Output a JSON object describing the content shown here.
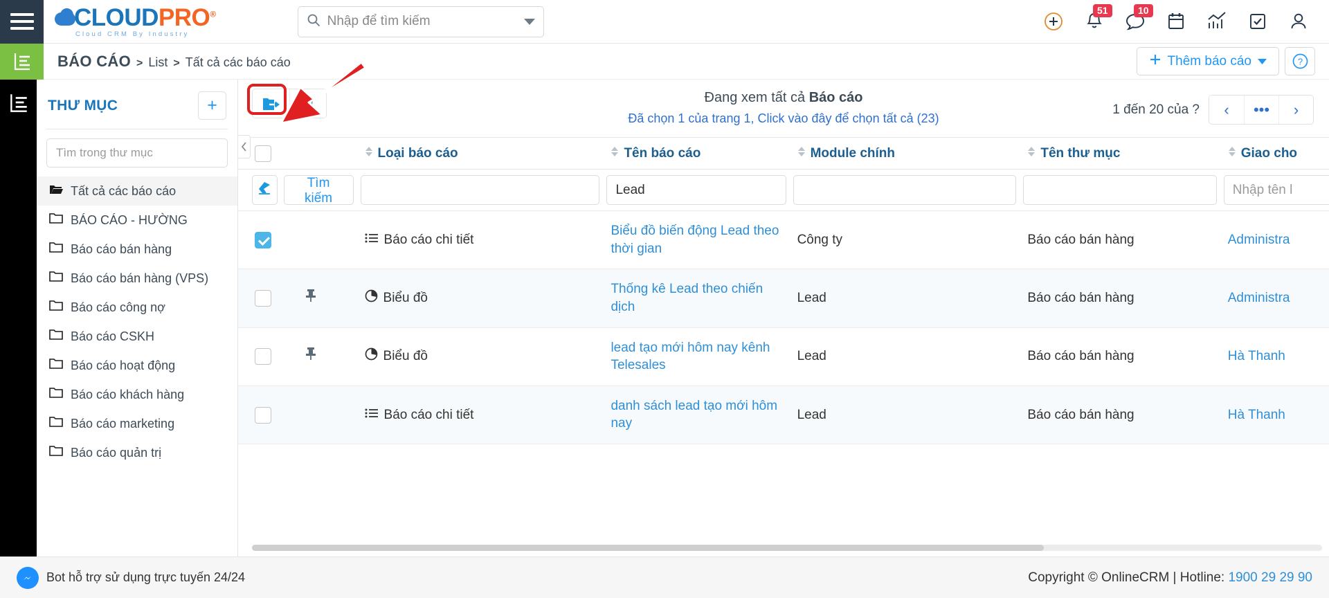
{
  "topbar": {
    "menu_icon": "hamburger-icon",
    "logo": {
      "part1": "CLOUD",
      "part2": "PRO",
      "reg": "®",
      "tagline": "Cloud CRM By Industry"
    },
    "search": {
      "placeholder": "Nhập để tìm kiếm",
      "value": ""
    },
    "icons": [
      {
        "name": "add-icon",
        "badge": ""
      },
      {
        "name": "notifications-icon",
        "badge": "51"
      },
      {
        "name": "messages-icon",
        "badge": "10"
      },
      {
        "name": "calendar-icon",
        "badge": ""
      },
      {
        "name": "analytics-icon",
        "badge": ""
      },
      {
        "name": "tasks-icon",
        "badge": ""
      },
      {
        "name": "user-profile-icon",
        "badge": ""
      }
    ]
  },
  "breadcrumb": {
    "module_icon": "report-module-icon",
    "title": "BÁO CÁO",
    "sep": ">",
    "item1": "List",
    "item2": "Tất cả các báo cáo",
    "add_button": "Thêm báo cáo",
    "help_button": "?"
  },
  "sidebar": {
    "title": "THƯ MỤC",
    "add_button": "+",
    "search_placeholder": "Tìm trong thư mục",
    "folders": [
      {
        "label": "Tất cả các báo cáo",
        "active": true
      },
      {
        "label": "BÁO CÁO - HƯỜNG",
        "active": false
      },
      {
        "label": "Báo cáo bán hàng",
        "active": false
      },
      {
        "label": "Báo cáo bán hàng (VPS)",
        "active": false
      },
      {
        "label": "Báo cáo công nợ",
        "active": false
      },
      {
        "label": "Báo cáo CSKH",
        "active": false
      },
      {
        "label": "Báo cáo hoạt động",
        "active": false
      },
      {
        "label": "Báo cáo khách hàng",
        "active": false
      },
      {
        "label": "Báo cáo marketing",
        "active": false
      },
      {
        "label": "Báo cáo quản trị",
        "active": false
      }
    ]
  },
  "toolbar": {
    "move_to_folder_label": "move-to-folder",
    "delete_label": "delete",
    "viewing_prefix": "Đang xem tất cả ",
    "viewing_bold": "Báo cáo",
    "selection_text": "Đã chọn 1 của trang 1, Click vào đây để chọn tất cả (23)",
    "pager_label": "1 đến 20 của ?",
    "pager_prev": "‹",
    "pager_more": "•••",
    "pager_next": "›"
  },
  "table": {
    "columns": [
      {
        "key": "checkbox",
        "label": ""
      },
      {
        "key": "pin",
        "label": ""
      },
      {
        "key": "type",
        "label": "Loại báo cáo"
      },
      {
        "key": "name",
        "label": "Tên báo cáo"
      },
      {
        "key": "module",
        "label": "Module chính"
      },
      {
        "key": "folder",
        "label": "Tên thư mục"
      },
      {
        "key": "assigned",
        "label": "Giao cho"
      }
    ],
    "filters": {
      "clear_label": "erase-icon",
      "search_label": "Tìm kiếm",
      "type_value": "",
      "name_value": "Lead",
      "module_value": "",
      "folder_value": "",
      "assigned_placeholder": "Nhập tên l"
    },
    "rows": [
      {
        "checked": true,
        "pinned": false,
        "type_icon": "detail-report-icon",
        "type": "Báo cáo chi tiết",
        "name": "Biểu đồ biến động Lead theo thời gian",
        "module": "Công ty",
        "folder": "Báo cáo bán hàng",
        "assigned": "Administra"
      },
      {
        "checked": false,
        "pinned": true,
        "type_icon": "chart-report-icon",
        "type": "Biểu đồ",
        "name": "Thống kê Lead theo chiến dịch",
        "module": "Lead",
        "folder": "Báo cáo bán hàng",
        "assigned": "Administra"
      },
      {
        "checked": false,
        "pinned": true,
        "type_icon": "chart-report-icon",
        "type": "Biểu đồ",
        "name": "lead tạo mới hôm nay kênh Telesales",
        "module": "Lead",
        "folder": "Báo cáo bán hàng",
        "assigned": "Hà Thanh"
      },
      {
        "checked": false,
        "pinned": false,
        "type_icon": "detail-report-icon",
        "type": "Báo cáo chi tiết",
        "name": "danh sách lead tạo mới hôm nay",
        "module": "Lead",
        "folder": "Báo cáo bán hàng",
        "assigned": "Hà Thanh"
      }
    ]
  },
  "footer": {
    "bot_text": "Bot hỗ trợ sử dụng trực tuyến 24/24",
    "copyright": "Copyright © OnlineCRM | Hotline: ",
    "hotline": "1900 29 29 90"
  },
  "colors": {
    "accent_blue": "#2196f3",
    "brand_blue": "#1b75bb",
    "brand_orange": "#f26522",
    "badge_red": "#e8384f",
    "green": "#7bc043",
    "dark": "#2b3a4a"
  }
}
